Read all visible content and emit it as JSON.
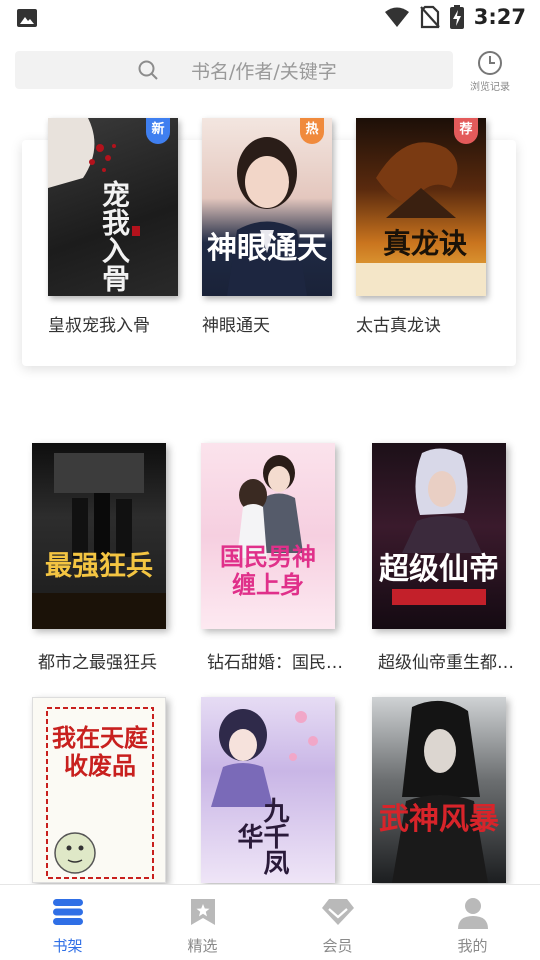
{
  "status_bar": {
    "time": "3:27"
  },
  "search": {
    "placeholder": "书名/作者/关键字",
    "history_label": "浏览记录"
  },
  "recommended": [
    {
      "title": "皇叔宠我入骨",
      "badge": "新",
      "badge_color": "#3f7ff0",
      "cover_text": "宠我入骨"
    },
    {
      "title": "神眼通天",
      "badge": "热",
      "badge_color": "#f08a3c",
      "cover_text": "神眼通天"
    },
    {
      "title": "太古真龙诀",
      "badge": "荐",
      "badge_color": "#e35a5a",
      "cover_text": "真龙诀"
    }
  ],
  "shelf": [
    {
      "title": "都市之最强狂兵",
      "cover_text": "最强狂兵"
    },
    {
      "title": "钻石甜婚：国民…",
      "cover_text": "国民男神缠上身"
    },
    {
      "title": "超级仙帝重生都…",
      "cover_text": "超级仙帝"
    },
    {
      "title": "",
      "cover_text": "我在天庭收废品"
    },
    {
      "title": "",
      "cover_text": "九千凤华"
    },
    {
      "title": "",
      "cover_text": "武神风暴"
    }
  ],
  "nav": [
    {
      "label": "书架",
      "icon": "bookshelf-icon",
      "active": true
    },
    {
      "label": "精选",
      "icon": "bookmark-icon",
      "active": false
    },
    {
      "label": "会员",
      "icon": "diamond-icon",
      "active": false
    },
    {
      "label": "我的",
      "icon": "user-icon",
      "active": false
    }
  ],
  "colors": {
    "accent": "#2f6fe6",
    "inactive": "#8a8a8a"
  }
}
